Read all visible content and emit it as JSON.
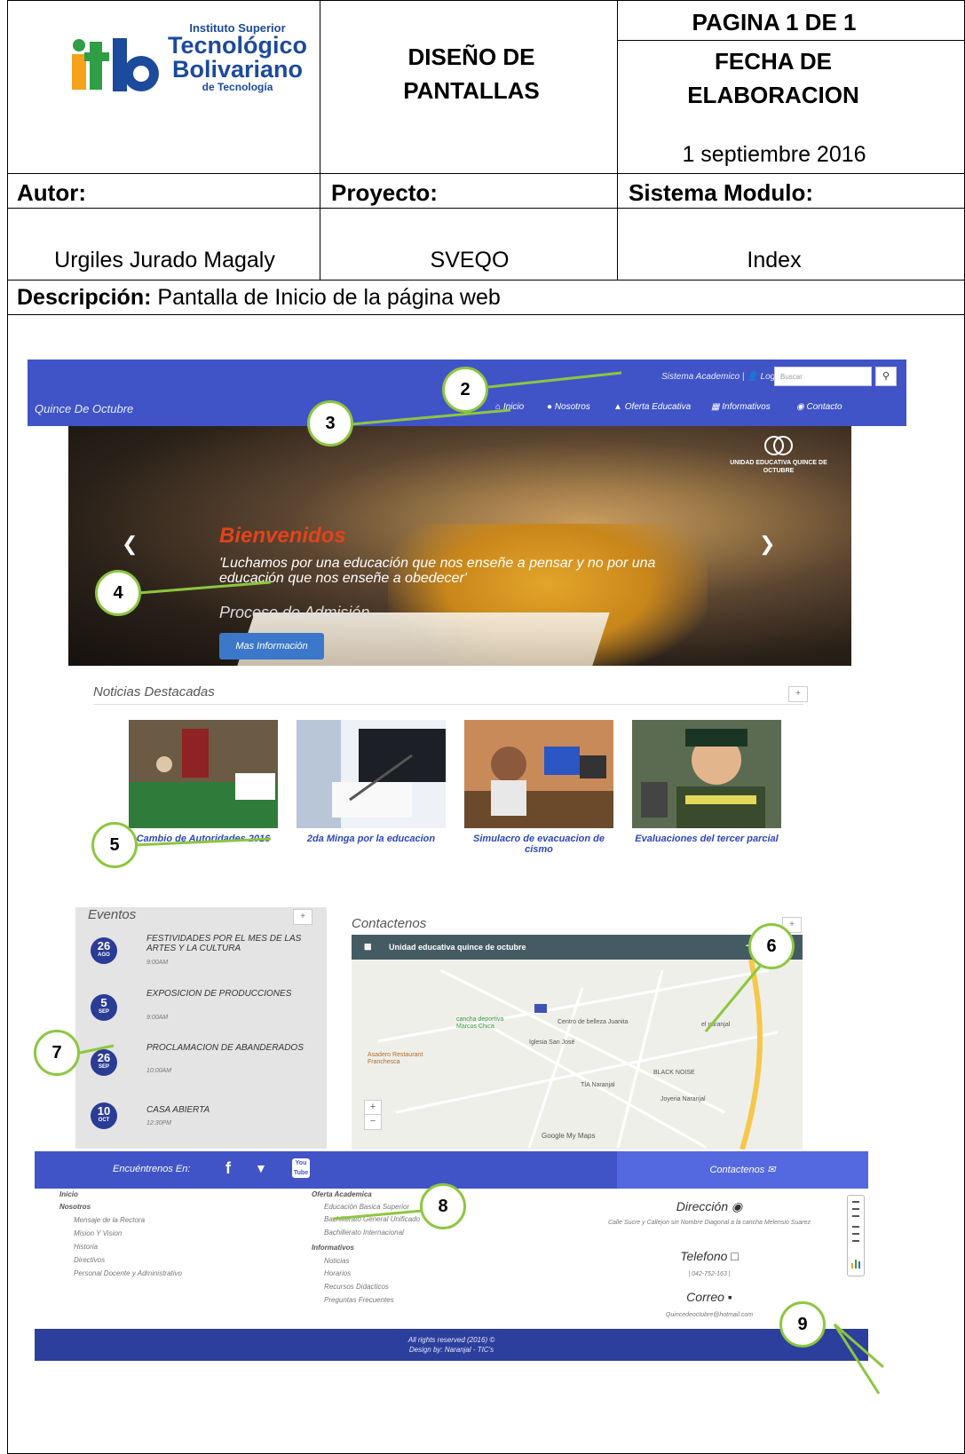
{
  "doc_header": {
    "logo": {
      "line1": "Instituto Superior",
      "line2": "Tecnológico",
      "line3": "Bolivariano",
      "line4": "de Tecnología",
      "mark": "itb"
    },
    "title": "DISEÑO DE PANTALLAS",
    "page": "PAGINA 1 DE 1",
    "date_label": "FECHA DE ELABORACION",
    "date_value": "1 septiembre 2016",
    "author_label": "Autor:",
    "author_value": "Urgiles Jurado Magaly",
    "project_label": "Proyecto:",
    "project_value": "SVEQO",
    "module_label": "Sistema Modulo:",
    "module_value": "Index",
    "desc_label": "Descripción:",
    "desc_value": "Pantalla de Inicio de la página web"
  },
  "site": {
    "brand": "Quince De Octubre",
    "top_links": "Sistema Academico | 👤 Login",
    "search_placeholder": "Buscar",
    "nav": [
      "Inicio",
      "Nosotros",
      "Oferta Educativa",
      "Informativos",
      "Contacto"
    ],
    "hero": {
      "title": "Bienvenidos",
      "quote": "'Luchamos por una educación que nos enseñe a pensar y no por una educación que nos enseñe a obedecer'",
      "subtitle": "Proceso de Admisión",
      "button": "Mas Información",
      "logo_text": "UNIDAD EDUCATIVA QUINCE DE OCTUBRE"
    },
    "news": {
      "title": "Noticias Destacadas",
      "items": [
        "Cambio de Autoridades 2016",
        "2da Minga por la educacion",
        "Simulacro de evacuacion de cismo",
        "Evaluaciones del tercer parcial"
      ]
    },
    "events": {
      "title": "Eventos",
      "items": [
        {
          "day": "26",
          "month": "AGO",
          "title": "FESTIVIDADES POR EL MES DE LAS ARTES Y LA CULTURA",
          "time": "9:00AM"
        },
        {
          "day": "5",
          "month": "SEP",
          "title": "EXPOSICION DE PRODUCCIONES",
          "time": "9:00AM"
        },
        {
          "day": "26",
          "month": "SEP",
          "title": "PROCLAMACION DE ABANDERADOS",
          "time": "10:00AM"
        },
        {
          "day": "10",
          "month": "OCT",
          "title": "CASA ABIERTA",
          "time": "12:30PM"
        }
      ]
    },
    "contact_section": {
      "title": "Contactenos",
      "map_title": "Unidad educativa quince de octubre",
      "map_labels": [
        "cancha deportiva Marcos Chica",
        "Centro de belleza Juanita",
        "Iglesia San José",
        "Asadero Restaurant Franchesca",
        "TÍA Naranjal",
        "BLACK NOISE",
        "Joyeria Naranjal",
        "el naranjal",
        "Google My Maps"
      ]
    },
    "footer": {
      "find_us": "Encuéntrenos En:",
      "contact_btn": "Contactenos ✉",
      "col1": {
        "head1": "Inicio",
        "head2": "Nosotros",
        "links": [
          "Mensaje de la Rectora",
          "Mision Y Vision",
          "Historia",
          "Directivos",
          "Personal Docente y Administrativo"
        ]
      },
      "col2": {
        "head1": "Oferta Academica",
        "links1": [
          "Educación Basica Superior",
          "Bachillerato General Unificado",
          "Bachillerato Internacional"
        ],
        "head2": "Informativos",
        "links2": [
          "Noticias",
          "Horarios",
          "Recursos Didacticos",
          "Preguntas Frecuentes"
        ]
      },
      "col3": {
        "dir_label": "Dirección",
        "dir_value": "Calle Sucre y Callejon sin Nombre Diagonal a la cancha Melensio Suarez",
        "tel_label": "Telefono",
        "tel_value": "| 042-752-163 |",
        "mail_label": "Correo",
        "mail_value": "Quincedeoctubre@hotmail.com"
      },
      "copyright": "All rights reserved (2016) ©",
      "design": "Design by: Naranjal - TIC's"
    }
  },
  "callouts": [
    "2",
    "3",
    "4",
    "5",
    "6",
    "7",
    "8",
    "9"
  ],
  "colors": {
    "nav_blue": "#4054c8",
    "accent_red": "#e2431b",
    "callout_green": "#8dc63f",
    "link_blue": "#2d47b9"
  }
}
